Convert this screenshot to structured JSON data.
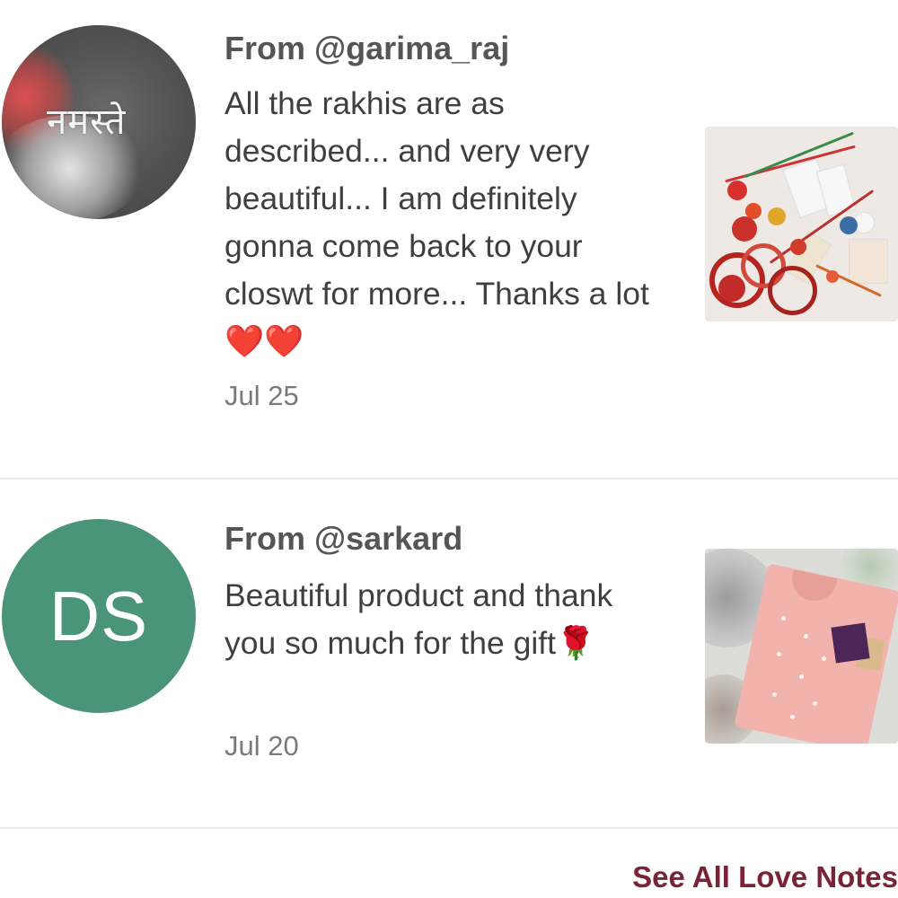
{
  "notes": [
    {
      "from": "From @garima_raj",
      "avatar_text": "नमस्ते",
      "message": "All the rakhis are as described... and very very beautiful... I am definitely gonna come back to your closwt for more... Thanks a lot ❤️❤️",
      "date": "Jul 25",
      "product_image": "rakhi-collection-photo"
    },
    {
      "from": "From @sarkard",
      "avatar_initials": "DS",
      "message": "Beautiful product and thank you so much for the gift🌹",
      "date": "Jul 20",
      "product_image": "pink-kurta-photo"
    }
  ],
  "see_all_label": "See All Love Notes",
  "colors": {
    "initials_avatar_bg": "#4a957a",
    "link_color": "#7a2236"
  }
}
